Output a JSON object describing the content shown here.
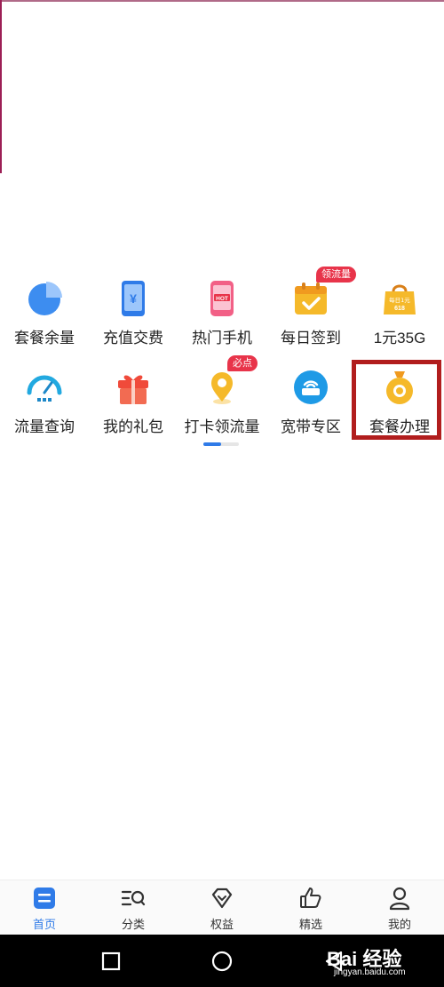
{
  "colors": {
    "accent": "#2f7be8",
    "highlight": "#b11d1d",
    "badge": "#e8344a"
  },
  "grid": {
    "row1": [
      {
        "label": "套餐余量",
        "icon": "pie-chart-icon"
      },
      {
        "label": "充值交费",
        "icon": "phone-yuan-icon"
      },
      {
        "label": "热门手机",
        "icon": "hot-phone-icon"
      },
      {
        "label": "每日签到",
        "icon": "calendar-check-icon",
        "badge": "领流量"
      },
      {
        "label": "1元35G",
        "icon": "shopping-bag-icon"
      }
    ],
    "row2": [
      {
        "label": "流量查询",
        "icon": "speedometer-icon"
      },
      {
        "label": "我的礼包",
        "icon": "gift-icon"
      },
      {
        "label": "打卡领流量",
        "icon": "location-pin-icon",
        "badge": "必点"
      },
      {
        "label": "宽带专区",
        "icon": "router-icon"
      },
      {
        "label": "套餐办理",
        "icon": "money-bag-icon"
      }
    ]
  },
  "icon_texts": {
    "hot": "HOT",
    "yuan": "¥",
    "bag_top": "每日1元",
    "bag_bottom": "618"
  },
  "tabbar": [
    {
      "label": "首页",
      "icon": "home-icon",
      "active": true
    },
    {
      "label": "分类",
      "icon": "category-search-icon"
    },
    {
      "label": "权益",
      "icon": "diamond-icon"
    },
    {
      "label": "精选",
      "icon": "thumbs-up-icon"
    },
    {
      "label": "我的",
      "icon": "person-icon"
    }
  ],
  "navbar": {
    "watermark_logo": "Bai 经验",
    "watermark_url": "jingyan.baidu.com"
  }
}
